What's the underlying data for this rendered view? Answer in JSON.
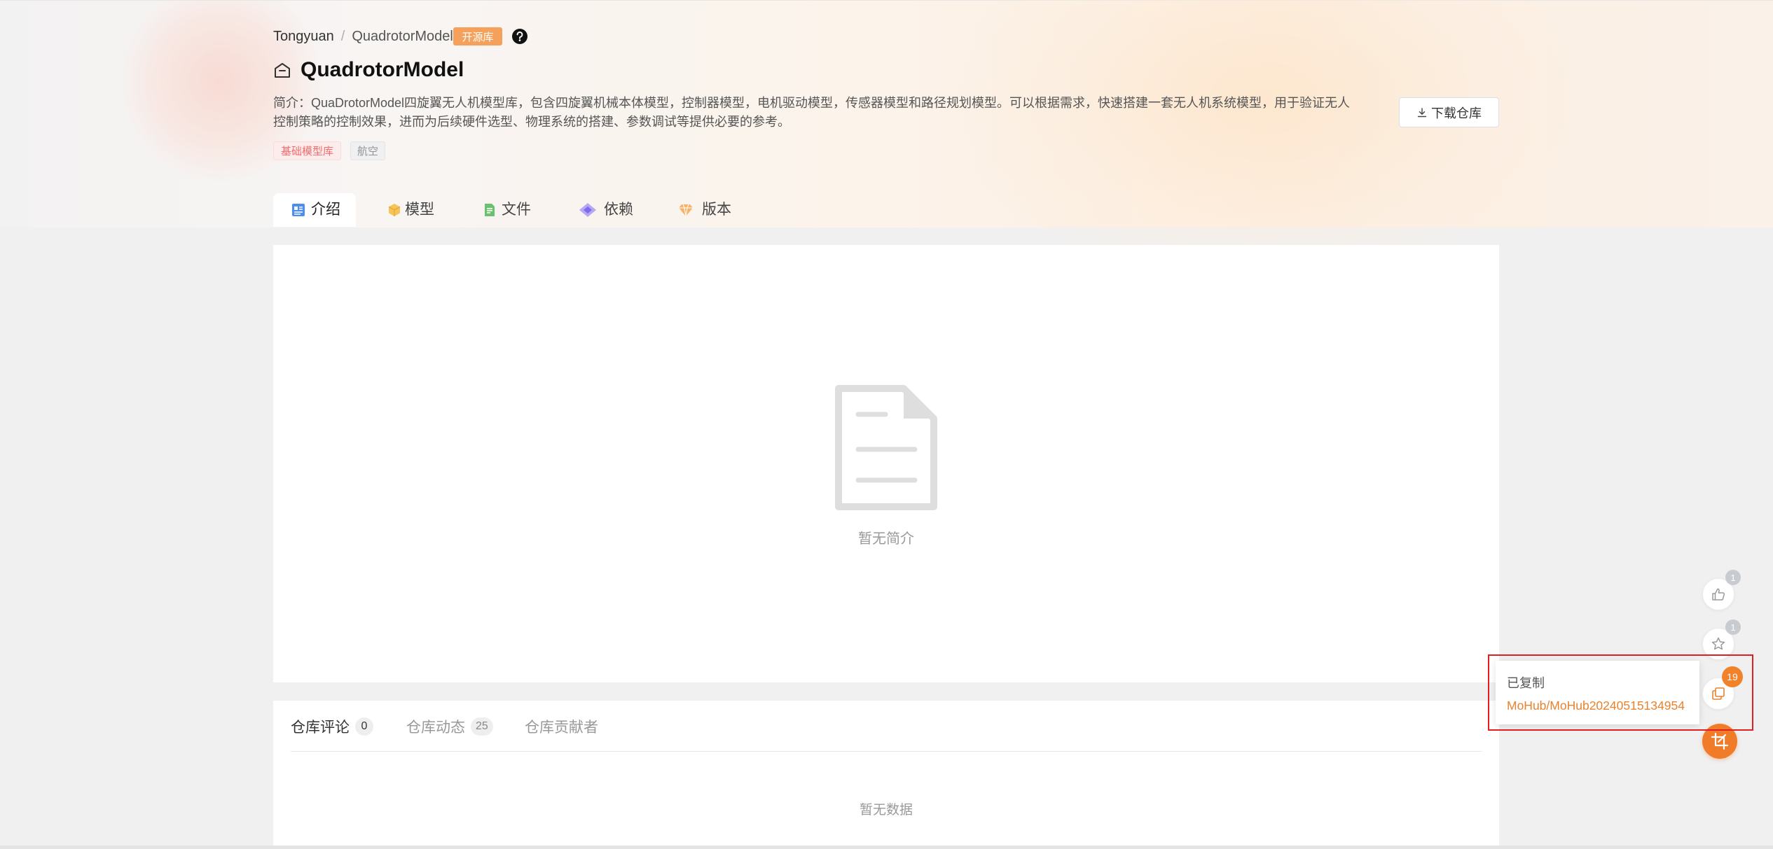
{
  "breadcrumb": {
    "owner": "Tongyuan",
    "separator": "/",
    "repo": "QuadrotorModel"
  },
  "badge": "开源库",
  "help_icon": "question-circle-icon",
  "title": "QuadrotorModel",
  "title_icon": "repository-home-icon",
  "description": "简介：QuaDrotorModel四旋翼无人机模型库，包含四旋翼机械本体模型，控制器模型，电机驱动模型，传感器模型和路径规划模型。可以根据需求，快速搭建一套无人机系统模型，用于验证无人控制策略的控制效果，进而为后续硬件选型、物理系统的搭建、参数调试等提供必要的参考。",
  "download_button": {
    "label": "下载仓库",
    "icon": "download-icon"
  },
  "tags": [
    {
      "label": "基础模型库",
      "color": "#f56c6c"
    },
    {
      "label": "航空",
      "color": "#909399"
    }
  ],
  "tabs": [
    {
      "label": "介绍",
      "icon": "intro-icon",
      "active": true
    },
    {
      "label": "模型",
      "icon": "model-icon",
      "active": false
    },
    {
      "label": "文件",
      "icon": "file-icon",
      "active": false
    },
    {
      "label": "依赖",
      "icon": "dependency-icon",
      "active": false
    },
    {
      "label": "版本",
      "icon": "version-icon",
      "active": false
    }
  ],
  "intro": {
    "empty_text": "暂无简介",
    "empty_icon": "empty-document-icon"
  },
  "activity": {
    "tabs": [
      {
        "label": "仓库评论",
        "count": "0",
        "active": true
      },
      {
        "label": "仓库动态",
        "count": "25",
        "active": false
      },
      {
        "label": "仓库贡献者",
        "active": false
      }
    ],
    "empty_text": "暂无数据"
  },
  "float_actions": {
    "like": {
      "icon": "thumbs-up-icon",
      "count": "1"
    },
    "star": {
      "icon": "star-icon",
      "count": "1"
    },
    "copy": {
      "icon": "copy-icon",
      "count": "19"
    },
    "main": {
      "icon": "crop-icon"
    }
  },
  "copy_popup": {
    "title": "已复制",
    "value": "MoHub/MoHub20240515134954"
  },
  "colors": {
    "accent": "#f07c29",
    "badge_open": "#f5a15b",
    "page_bg": "#f0f0f0",
    "annotation": "#e02020"
  }
}
